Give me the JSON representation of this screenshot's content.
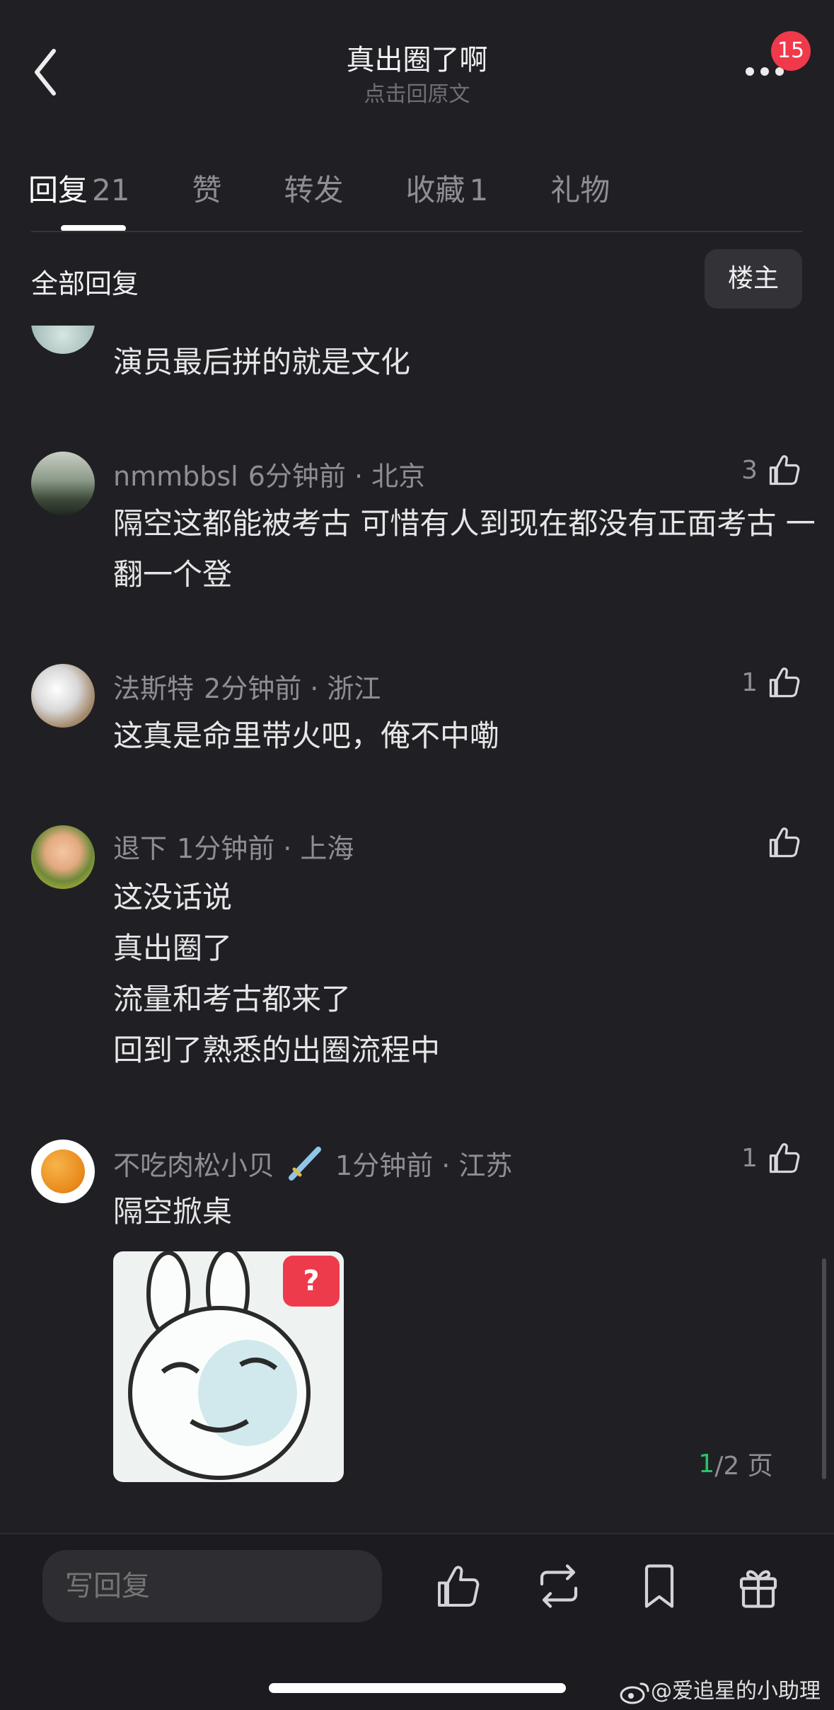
{
  "header": {
    "title": "真出圈了啊",
    "subtitle": "点击回原文",
    "notification_count": "15"
  },
  "tabs": [
    {
      "label": "回复",
      "count": "21"
    },
    {
      "label": "赞",
      "count": ""
    },
    {
      "label": "转发",
      "count": ""
    },
    {
      "label": "收藏",
      "count": "1"
    },
    {
      "label": "礼物",
      "count": ""
    }
  ],
  "filter": {
    "all_replies": "全部回复",
    "op_only": "楼主"
  },
  "comments": [
    {
      "username": "",
      "meta": "",
      "likes": "",
      "text": "演员最后拼的就是文化"
    },
    {
      "username": "nmmbbsl",
      "meta": "6分钟前 · 北京",
      "likes": "3",
      "text": "隔空这都能被考古 可惜有人到现在都没有正面考古 一翻一个登"
    },
    {
      "username": "法斯特",
      "meta": "2分钟前 · 浙江",
      "likes": "1",
      "text": "这真是命里带火吧，俺不中嘞"
    },
    {
      "username": "退下",
      "meta": "1分钟前 · 上海",
      "likes": "",
      "text": "这没话说\n真出圈了\n流量和考古都来了\n回到了熟悉的出圈流程中"
    },
    {
      "username": "不吃肉松小贝",
      "meta": "1分钟前 · 江苏",
      "likes": "1",
      "text": "隔空掀桌"
    }
  ],
  "sticker": {
    "badge": "?"
  },
  "pagination": {
    "current": "1",
    "total": "/2 页"
  },
  "bottom_bar": {
    "reply_placeholder": "写回复"
  },
  "watermark": "@爱追星的小助理",
  "colors": {
    "background": "#202024",
    "accent_green": "#27c26a",
    "badge_red": "#f0394a"
  }
}
